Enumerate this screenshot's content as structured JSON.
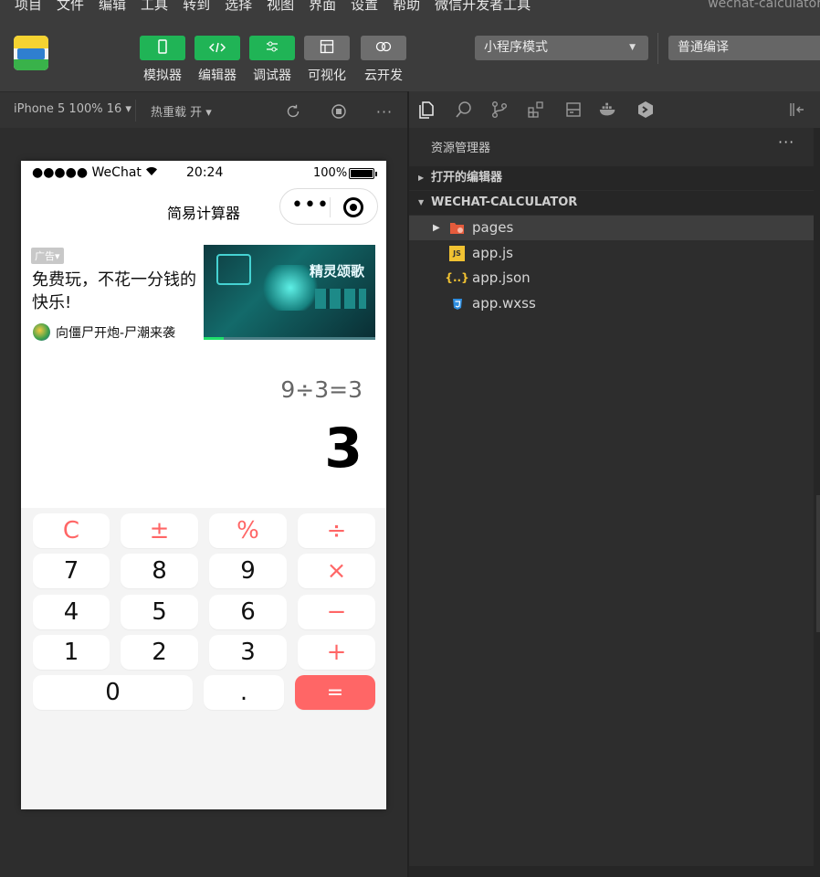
{
  "menubar": {
    "items": [
      "项目",
      "文件",
      "编辑",
      "工具",
      "转到",
      "选择",
      "视图",
      "界面",
      "设置",
      "帮助",
      "微信开发者工具"
    ],
    "window_title": "wechat-calculator"
  },
  "toolbar": {
    "buttons": [
      {
        "label": "模拟器",
        "icon": "phone-icon"
      },
      {
        "label": "编辑器",
        "icon": "code-icon"
      },
      {
        "label": "调试器",
        "icon": "sliders-icon"
      },
      {
        "label": "可视化",
        "icon": "layout-icon"
      },
      {
        "label": "云开发",
        "icon": "cloud-icon"
      }
    ],
    "mode_select": "小程序模式",
    "compile_select": "普通编译"
  },
  "simulator_bar": {
    "device": "iPhone 5 100% 16",
    "hot_reload": "热重载 开"
  },
  "phone": {
    "status": {
      "carrier": "●●●●● WeChat",
      "time": "20:24",
      "battery": "100%"
    },
    "nav_title": "简易计算器",
    "ad": {
      "tag": "广告",
      "text": "免费玩，不花一分钱的快乐!",
      "sponsor": "向僵尸开炮-尸潮来袭",
      "banner_text": "精灵颂歌"
    },
    "display": {
      "expression": "9÷3=3",
      "result": "3"
    },
    "keys": [
      "C",
      "±",
      "%",
      "÷",
      "7",
      "8",
      "9",
      "×",
      "4",
      "5",
      "6",
      "−",
      "1",
      "2",
      "3",
      "+",
      "0",
      ".",
      "="
    ]
  },
  "explorer": {
    "title": "资源管理器",
    "more": "···",
    "sections": {
      "open_editors": "打开的编辑器",
      "project": "WECHAT-CALCULATOR"
    },
    "files": [
      {
        "name": "pages",
        "type": "folder"
      },
      {
        "name": "app.js",
        "type": "js"
      },
      {
        "name": "app.json",
        "type": "json"
      },
      {
        "name": "app.wxss",
        "type": "css"
      }
    ]
  },
  "colors": {
    "accent_green": "#20b456",
    "operator_red": "#ff6666",
    "panel_dark": "#2d2d2d"
  }
}
